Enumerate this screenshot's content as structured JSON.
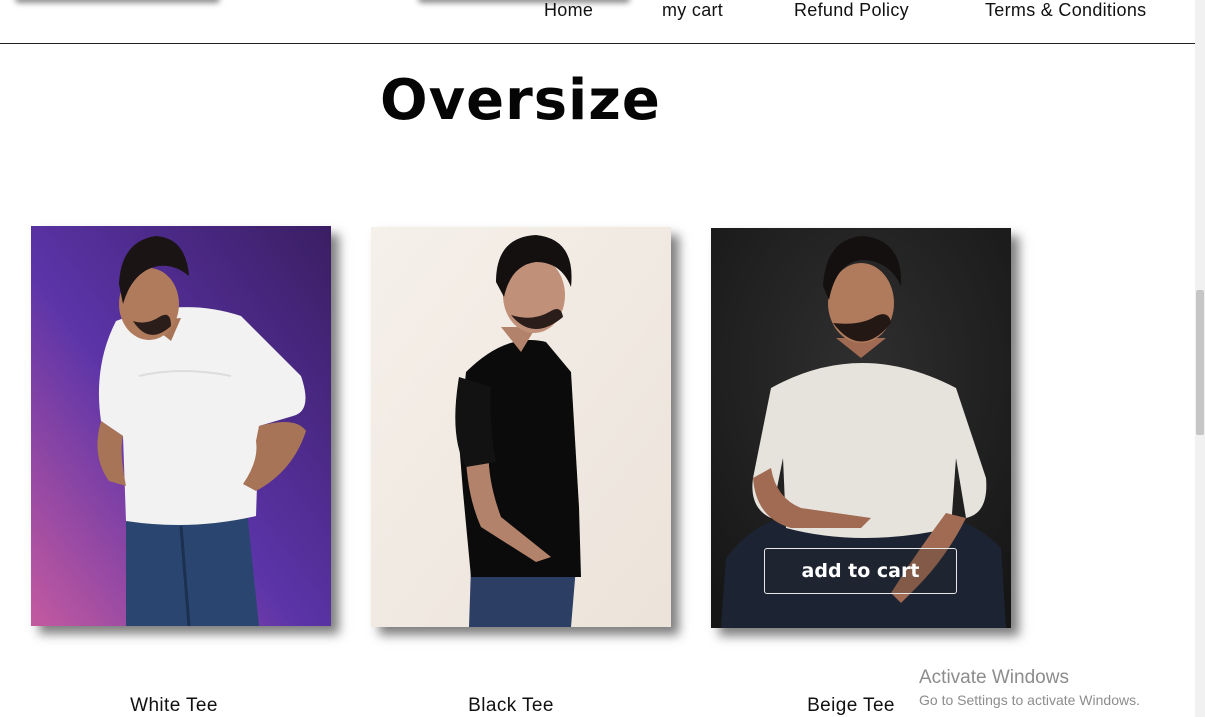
{
  "nav": {
    "items": [
      {
        "label": "Home"
      },
      {
        "label": "my cart"
      },
      {
        "label": "Refund Policy"
      },
      {
        "label": "Terms & Conditions"
      }
    ]
  },
  "page": {
    "title": "Oversize"
  },
  "products": [
    {
      "name": "White Tee",
      "image_icon": "model-white-tee-photo",
      "bg_colors": [
        "#3a1e63",
        "#5b34a8",
        "#c45aa0"
      ]
    },
    {
      "name": "Black Tee",
      "image_icon": "model-black-tee-photo",
      "bg_colors": [
        "#f5f0ea",
        "#ece3da"
      ]
    },
    {
      "name": "Beige Tee",
      "image_icon": "model-beige-tee-photo",
      "bg_colors": [
        "#1c1c1c",
        "#2f2f2f"
      ],
      "add_to_cart_label": "add to cart"
    }
  ],
  "watermark": {
    "line1": "Activate Windows",
    "line2": "Go to Settings to activate Windows."
  },
  "colors": {
    "text": "#111111",
    "nav_border": "#222222",
    "scroll_thumb": "#c6c6c6"
  }
}
